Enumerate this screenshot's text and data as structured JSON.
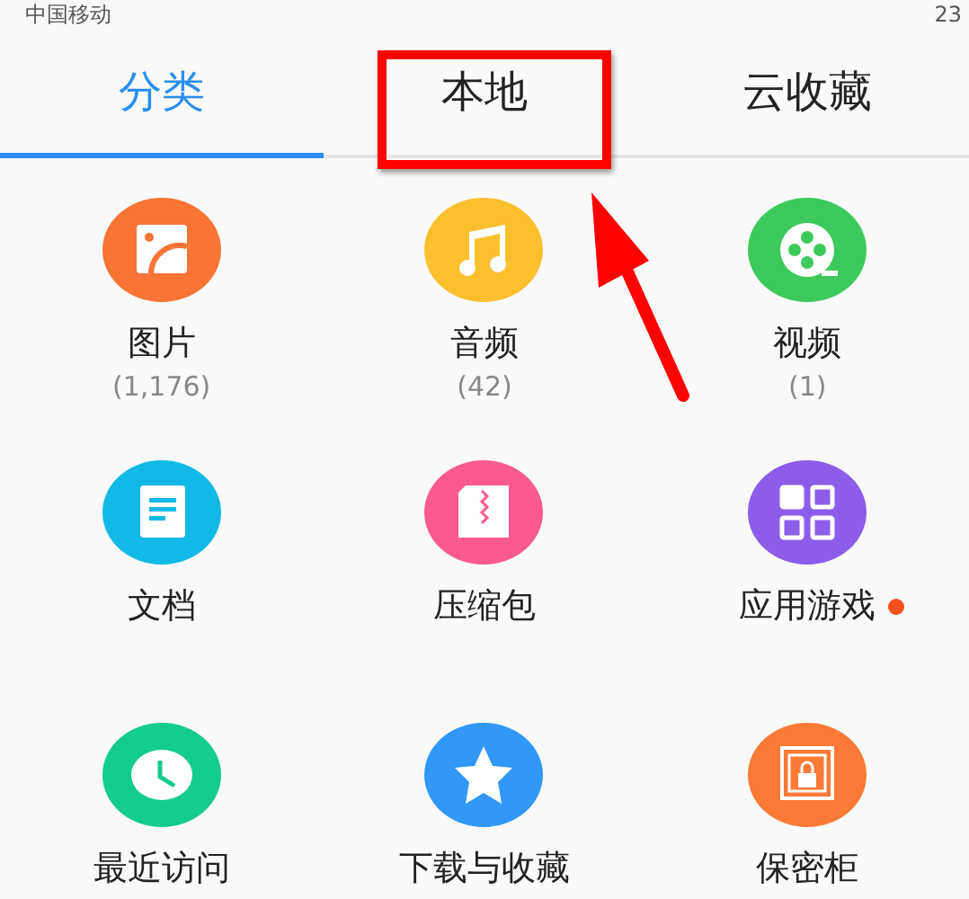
{
  "status_bar": {
    "carrier": "中国移动",
    "time": "23"
  },
  "tabs": [
    {
      "label": "分类",
      "selected": true
    },
    {
      "label": "本地",
      "selected": false,
      "highlighted": true
    },
    {
      "label": "云收藏",
      "selected": false
    }
  ],
  "categories": [
    {
      "kind": "image",
      "label": "图片",
      "count": "(1,176)",
      "color": "#fa7436",
      "dot": false
    },
    {
      "kind": "music",
      "label": "音频",
      "count": "(42)",
      "color": "#fcc02f",
      "dot": false
    },
    {
      "kind": "video",
      "label": "视频",
      "count": "(1)",
      "color": "#3ec95c",
      "dot": false
    },
    {
      "kind": "document",
      "label": "文档",
      "color": "#12b9e6",
      "dot": false
    },
    {
      "kind": "archive",
      "label": "压缩包",
      "color": "#fb5991",
      "dot": false
    },
    {
      "kind": "apps",
      "label": "应用游戏",
      "color": "#8c5de9",
      "dot": true
    },
    {
      "kind": "recent",
      "label": "最近访问",
      "color": "#14cc8c",
      "dot": false
    },
    {
      "kind": "favorite",
      "label": "下载与收藏",
      "color": "#3198f9",
      "dot": false
    },
    {
      "kind": "safe",
      "label": "保密柜",
      "color": "#fb7a36",
      "dot": false
    }
  ]
}
